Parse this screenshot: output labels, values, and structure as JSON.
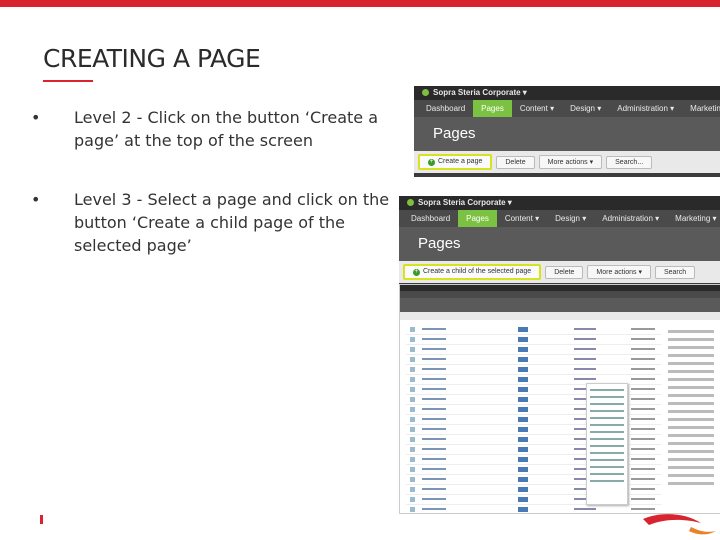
{
  "slide": {
    "title": "CREATING A PAGE",
    "bullets": [
      {
        "marker": "•",
        "text": "Level 2 - Click on the button ‘Create a page’ at the top of the screen"
      },
      {
        "marker": "•",
        "text": "Level 3 - Select a page and click on the button ‘Create a child page of the selected page’"
      }
    ]
  },
  "screenshot1": {
    "brand": "Sopra Steria Corporate ▾",
    "nav": [
      "Dashboard",
      "Pages",
      "Content ▾",
      "Design ▾",
      "Administration ▾",
      "Marketing ▾"
    ],
    "heading": "Pages",
    "buttons": [
      "Create a page",
      "Delete",
      "More actions ▾",
      "Search..."
    ]
  },
  "screenshot2": {
    "brand": "Sopra Steria Corporate ▾",
    "nav": [
      "Dashboard",
      "Pages",
      "Content ▾",
      "Design ▾",
      "Administration ▾",
      "Marketing ▾"
    ],
    "heading": "Pages",
    "buttons": [
      "Create a child of the selected page",
      "Delete",
      "More actions ▾",
      "Search"
    ]
  },
  "colors": {
    "accent": "#d8242e",
    "nav_active": "#7cc242",
    "highlight": "#d9e21f"
  }
}
